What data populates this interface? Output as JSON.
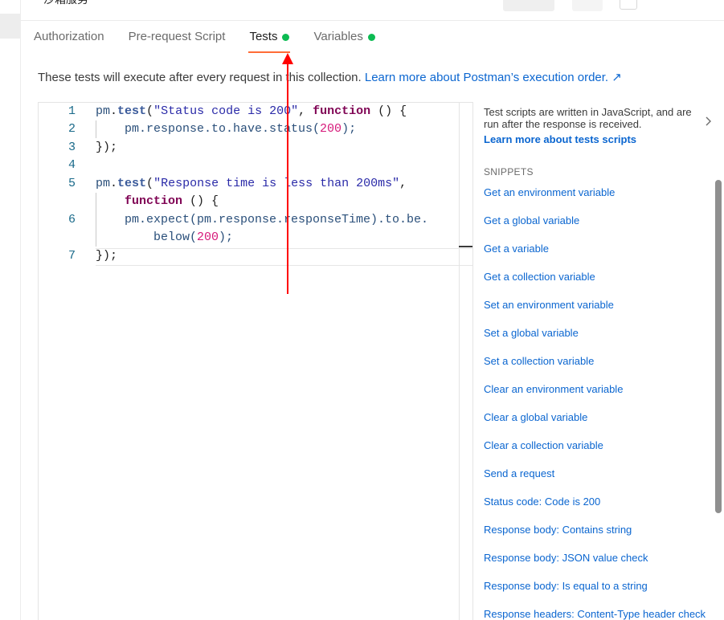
{
  "header": {
    "title": "沙箱服务"
  },
  "tabs": [
    {
      "label": "Authorization",
      "active": false,
      "has_dot": false
    },
    {
      "label": "Pre-request Script",
      "active": false,
      "has_dot": false
    },
    {
      "label": "Tests",
      "active": true,
      "has_dot": true
    },
    {
      "label": "Variables",
      "active": false,
      "has_dot": true
    }
  ],
  "description": {
    "text": "These tests will execute after every request in this collection.",
    "link": "Learn more about Postman’s execution order. ↗"
  },
  "editor": {
    "line_numbers": [
      "1",
      "2",
      "3",
      "4",
      "5",
      "",
      "6",
      "",
      "7"
    ],
    "code": {
      "l1_obj": "pm",
      "l1_dot": ".",
      "l1_fn": "test",
      "l1_open": "(",
      "l1_str": "\"Status code is 200\"",
      "l1_comma": ", ",
      "l1_kw": "function",
      "l1_end": " () {",
      "l2_text": "pm.response.to.have.status(",
      "l2_num": "200",
      "l2_end": ");",
      "l3_text": "});",
      "l5_obj": "pm",
      "l5_dot": ".",
      "l5_fn": "test",
      "l5_open": "(",
      "l5_str": "\"Response time is less than 200ms\"",
      "l5_end": ",",
      "l5b_kw": "function",
      "l5b_end": " () {",
      "l6_text": "pm.expect(pm.response.responseTime).to.be.",
      "l6b_text": "below(",
      "l6b_num": "200",
      "l6b_end": ");",
      "l7_text": "});"
    }
  },
  "side_panel": {
    "info_text": "Test scripts are written in JavaScript, and are run after the response is received.",
    "info_link": "Learn more about tests scripts",
    "snippets_title": "SNIPPETS",
    "snippets": [
      "Get an environment variable",
      "Get a global variable",
      "Get a variable",
      "Get a collection variable",
      "Set an environment variable",
      "Set a global variable",
      "Set a collection variable",
      "Clear an environment variable",
      "Clear a global variable",
      "Clear a collection variable",
      "Send a request",
      "Status code: Code is 200",
      "Response body: Contains string",
      "Response body: JSON value check",
      "Response body: Is equal to a string",
      "Response headers: Content-Type header check"
    ]
  },
  "colors": {
    "accent": "#ff6c37",
    "status_dot": "#0cbb52",
    "link": "#0b66d0",
    "annotation_arrow": "#ff0000"
  }
}
